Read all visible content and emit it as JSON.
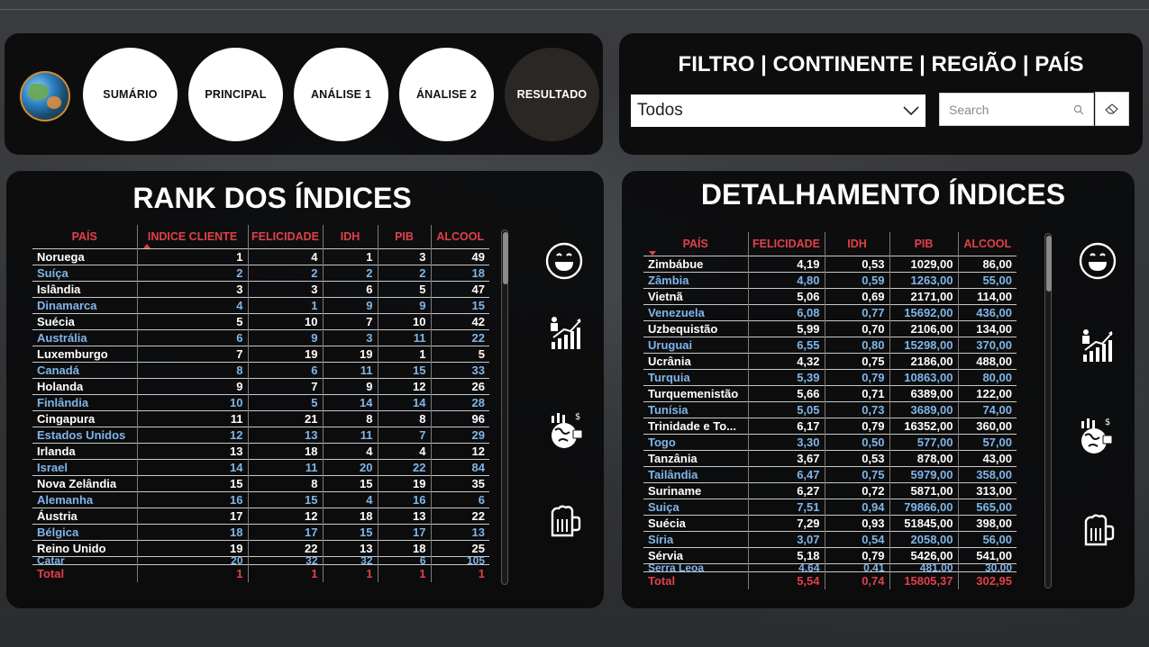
{
  "nav": {
    "logo": "globe-logo",
    "buttons": [
      {
        "label": "SUMÁRIO",
        "active": false
      },
      {
        "label": "PRINCIPAL",
        "active": false
      },
      {
        "label": "ANÁLISE 1",
        "active": false
      },
      {
        "label": "ÁNALISE 2",
        "active": false
      },
      {
        "label": "RESULTADO",
        "active": true
      }
    ]
  },
  "filter": {
    "title": "FILTRO | CONTINENTE | REGIÃO | PAÍS",
    "dropdown_value": "Todos",
    "search_placeholder": "Search"
  },
  "rank": {
    "title": "RANK DOS ÍNDICES",
    "columns": [
      "PAÍS",
      "INDICE CLIENTE",
      "FELICIDADE",
      "IDH",
      "PIB",
      "ALCOOL"
    ],
    "rows": [
      [
        "Noruega",
        "1",
        "4",
        "1",
        "3",
        "49"
      ],
      [
        "Suíça",
        "2",
        "2",
        "2",
        "2",
        "18"
      ],
      [
        "Islândia",
        "3",
        "3",
        "6",
        "5",
        "47"
      ],
      [
        "Dinamarca",
        "4",
        "1",
        "9",
        "9",
        "15"
      ],
      [
        "Suécia",
        "5",
        "10",
        "7",
        "10",
        "42"
      ],
      [
        "Austrália",
        "6",
        "9",
        "3",
        "11",
        "22"
      ],
      [
        "Luxemburgo",
        "7",
        "19",
        "19",
        "1",
        "5"
      ],
      [
        "Canadá",
        "8",
        "6",
        "11",
        "15",
        "33"
      ],
      [
        "Holanda",
        "9",
        "7",
        "9",
        "12",
        "26"
      ],
      [
        "Finlândia",
        "10",
        "5",
        "14",
        "14",
        "28"
      ],
      [
        "Cingapura",
        "11",
        "21",
        "8",
        "8",
        "96"
      ],
      [
        "Estados Unidos",
        "12",
        "13",
        "11",
        "7",
        "29"
      ],
      [
        "Irlanda",
        "13",
        "18",
        "4",
        "4",
        "12"
      ],
      [
        "Israel",
        "14",
        "11",
        "20",
        "22",
        "84"
      ],
      [
        "Nova Zelândia",
        "15",
        "8",
        "15",
        "19",
        "35"
      ],
      [
        "Alemanha",
        "16",
        "15",
        "4",
        "16",
        "6"
      ],
      [
        "Áustria",
        "17",
        "12",
        "18",
        "13",
        "22"
      ],
      [
        "Bélgica",
        "18",
        "17",
        "15",
        "17",
        "13"
      ],
      [
        "Reino Unido",
        "19",
        "22",
        "13",
        "18",
        "25"
      ],
      [
        "Catar",
        "20",
        "32",
        "32",
        "6",
        "105"
      ]
    ],
    "total": [
      "Total",
      "1",
      "1",
      "1",
      "1",
      "1"
    ]
  },
  "detail": {
    "title": "DETALHAMENTO ÍNDICES",
    "columns": [
      "PAÍS",
      "FELICIDADE",
      "IDH",
      "PIB",
      "ALCOOL"
    ],
    "rows": [
      [
        "Zimbábue",
        "4,19",
        "0,53",
        "1029,00",
        "86,00"
      ],
      [
        "Zâmbia",
        "4,80",
        "0,59",
        "1263,00",
        "55,00"
      ],
      [
        "Vietnã",
        "5,06",
        "0,69",
        "2171,00",
        "114,00"
      ],
      [
        "Venezuela",
        "6,08",
        "0,77",
        "15692,00",
        "436,00"
      ],
      [
        "Uzbequistão",
        "5,99",
        "0,70",
        "2106,00",
        "134,00"
      ],
      [
        "Uruguai",
        "6,55",
        "0,80",
        "15298,00",
        "370,00"
      ],
      [
        "Ucrânia",
        "4,32",
        "0,75",
        "2186,00",
        "488,00"
      ],
      [
        "Turquia",
        "5,39",
        "0,79",
        "10863,00",
        "80,00"
      ],
      [
        "Turquemenistão",
        "5,66",
        "0,71",
        "6389,00",
        "122,00"
      ],
      [
        "Tunísia",
        "5,05",
        "0,73",
        "3689,00",
        "74,00"
      ],
      [
        "Trinidade e To...",
        "6,17",
        "0,79",
        "16352,00",
        "360,00"
      ],
      [
        "Togo",
        "3,30",
        "0,50",
        "577,00",
        "57,00"
      ],
      [
        "Tanzânia",
        "3,67",
        "0,53",
        "878,00",
        "43,00"
      ],
      [
        "Tailândia",
        "6,47",
        "0,75",
        "5979,00",
        "358,00"
      ],
      [
        "Suriname",
        "6,27",
        "0,72",
        "5871,00",
        "313,00"
      ],
      [
        "Suiça",
        "7,51",
        "0,94",
        "79866,00",
        "565,00"
      ],
      [
        "Suécia",
        "7,29",
        "0,93",
        "51845,00",
        "398,00"
      ],
      [
        "Síria",
        "3,07",
        "0,54",
        "2058,00",
        "56,00"
      ],
      [
        "Sérvia",
        "5,18",
        "0,79",
        "5426,00",
        "541,00"
      ],
      [
        "Serra Leoa",
        "4,64",
        "0,41",
        "481,00",
        "30,00"
      ]
    ],
    "total": [
      "Total",
      "5,54",
      "0,74",
      "15805,37",
      "302,95"
    ]
  },
  "side_icons": [
    "smiley-icon",
    "growth-chart-icon",
    "global-economy-icon",
    "beer-mug-icon"
  ]
}
